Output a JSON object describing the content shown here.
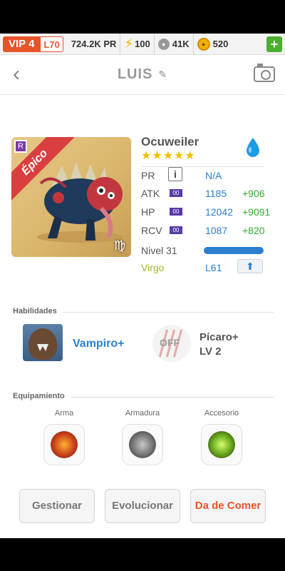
{
  "status_bar": {
    "vip": "VIP 4",
    "level": "L70",
    "power": "724.2K PR",
    "energy": "100",
    "food": "41K",
    "gold": "520",
    "add": "+"
  },
  "header": {
    "back_icon": "‹",
    "title": "LUIS",
    "edit_icon": "pencil-icon",
    "camera_icon": "camera-icon"
  },
  "monster": {
    "rarity": "Épico",
    "rank_badge": "R",
    "zodiac_glyph": "♍",
    "name": "Ocuweiler",
    "stars": "★★★★★",
    "element_color": "#1e9be6",
    "stats": {
      "pr": {
        "label": "PR",
        "info": "i",
        "value": "N/A"
      },
      "atk": {
        "label": "ATK",
        "tag": "00",
        "value": "1185",
        "bonus": "+906"
      },
      "hp": {
        "label": "HP",
        "tag": "00",
        "value": "12042",
        "bonus": "+9091"
      },
      "rcv": {
        "label": "RCV",
        "tag": "00",
        "value": "1087",
        "bonus": "+820"
      }
    },
    "nivel": "Nivel 31",
    "sign": "Virgo",
    "rank_level": "L61",
    "up_icon": "⬆"
  },
  "skills": {
    "title": "Habilidades",
    "skill1": {
      "name": "Vampiro+"
    },
    "skill2": {
      "state": "OFF",
      "name": "Pícaro+",
      "level": "LV 2"
    }
  },
  "equipment": {
    "title": "Equipamiento",
    "slots": [
      {
        "label": "Arma"
      },
      {
        "label": "Armadura"
      },
      {
        "label": "Accesorio"
      }
    ]
  },
  "buttons": {
    "manage": "Gestionar",
    "evolve": "Evolucionar",
    "feed": "Da de Comer"
  }
}
